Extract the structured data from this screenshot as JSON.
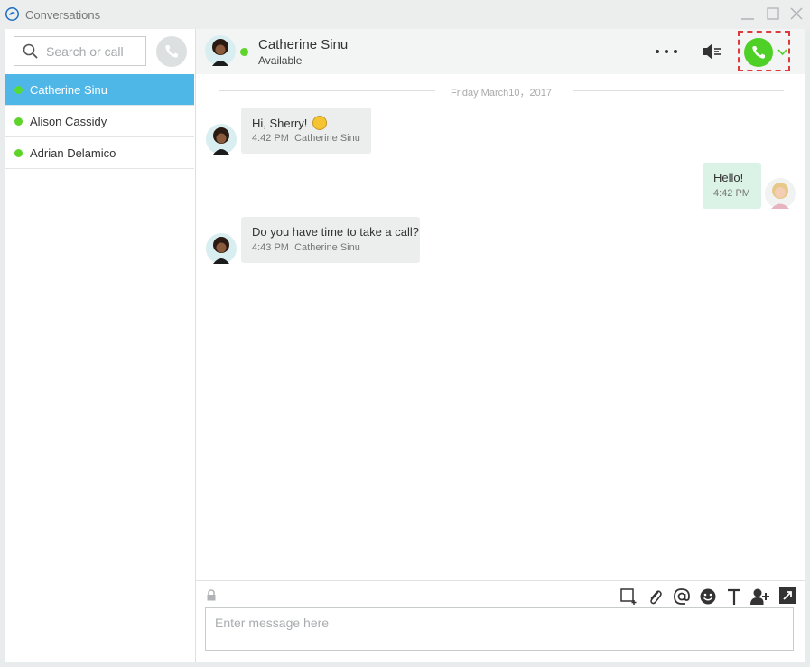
{
  "window": {
    "title": "Conversations"
  },
  "sidebar": {
    "search_placeholder": "Search or call",
    "contacts": [
      {
        "name": "Catherine Sinu",
        "presence": "available",
        "selected": true
      },
      {
        "name": "Alison Cassidy",
        "presence": "available",
        "selected": false
      },
      {
        "name": "Adrian Delamico",
        "presence": "available",
        "selected": false
      }
    ]
  },
  "chat": {
    "contact_name": "Catherine Sinu",
    "status": "Available",
    "date_separator": "Friday March10，2017",
    "messages": [
      {
        "text": "Hi, Sherry!",
        "emoji": "smiley",
        "time": "4:42 PM",
        "sender": "Catherine Sinu",
        "from_me": false
      },
      {
        "text": "Hello!",
        "time": "4:42 PM",
        "sender": "",
        "from_me": true
      },
      {
        "text": "Do you have time to take a call?",
        "time": "4:43 PM",
        "sender": "Catherine Sinu",
        "from_me": false
      }
    ],
    "compose_placeholder": "Enter message here"
  },
  "colors": {
    "accent": "#4fb6e8",
    "presence": "#5ed32a",
    "call_green": "#4fd027",
    "highlight": "#e0393b"
  }
}
